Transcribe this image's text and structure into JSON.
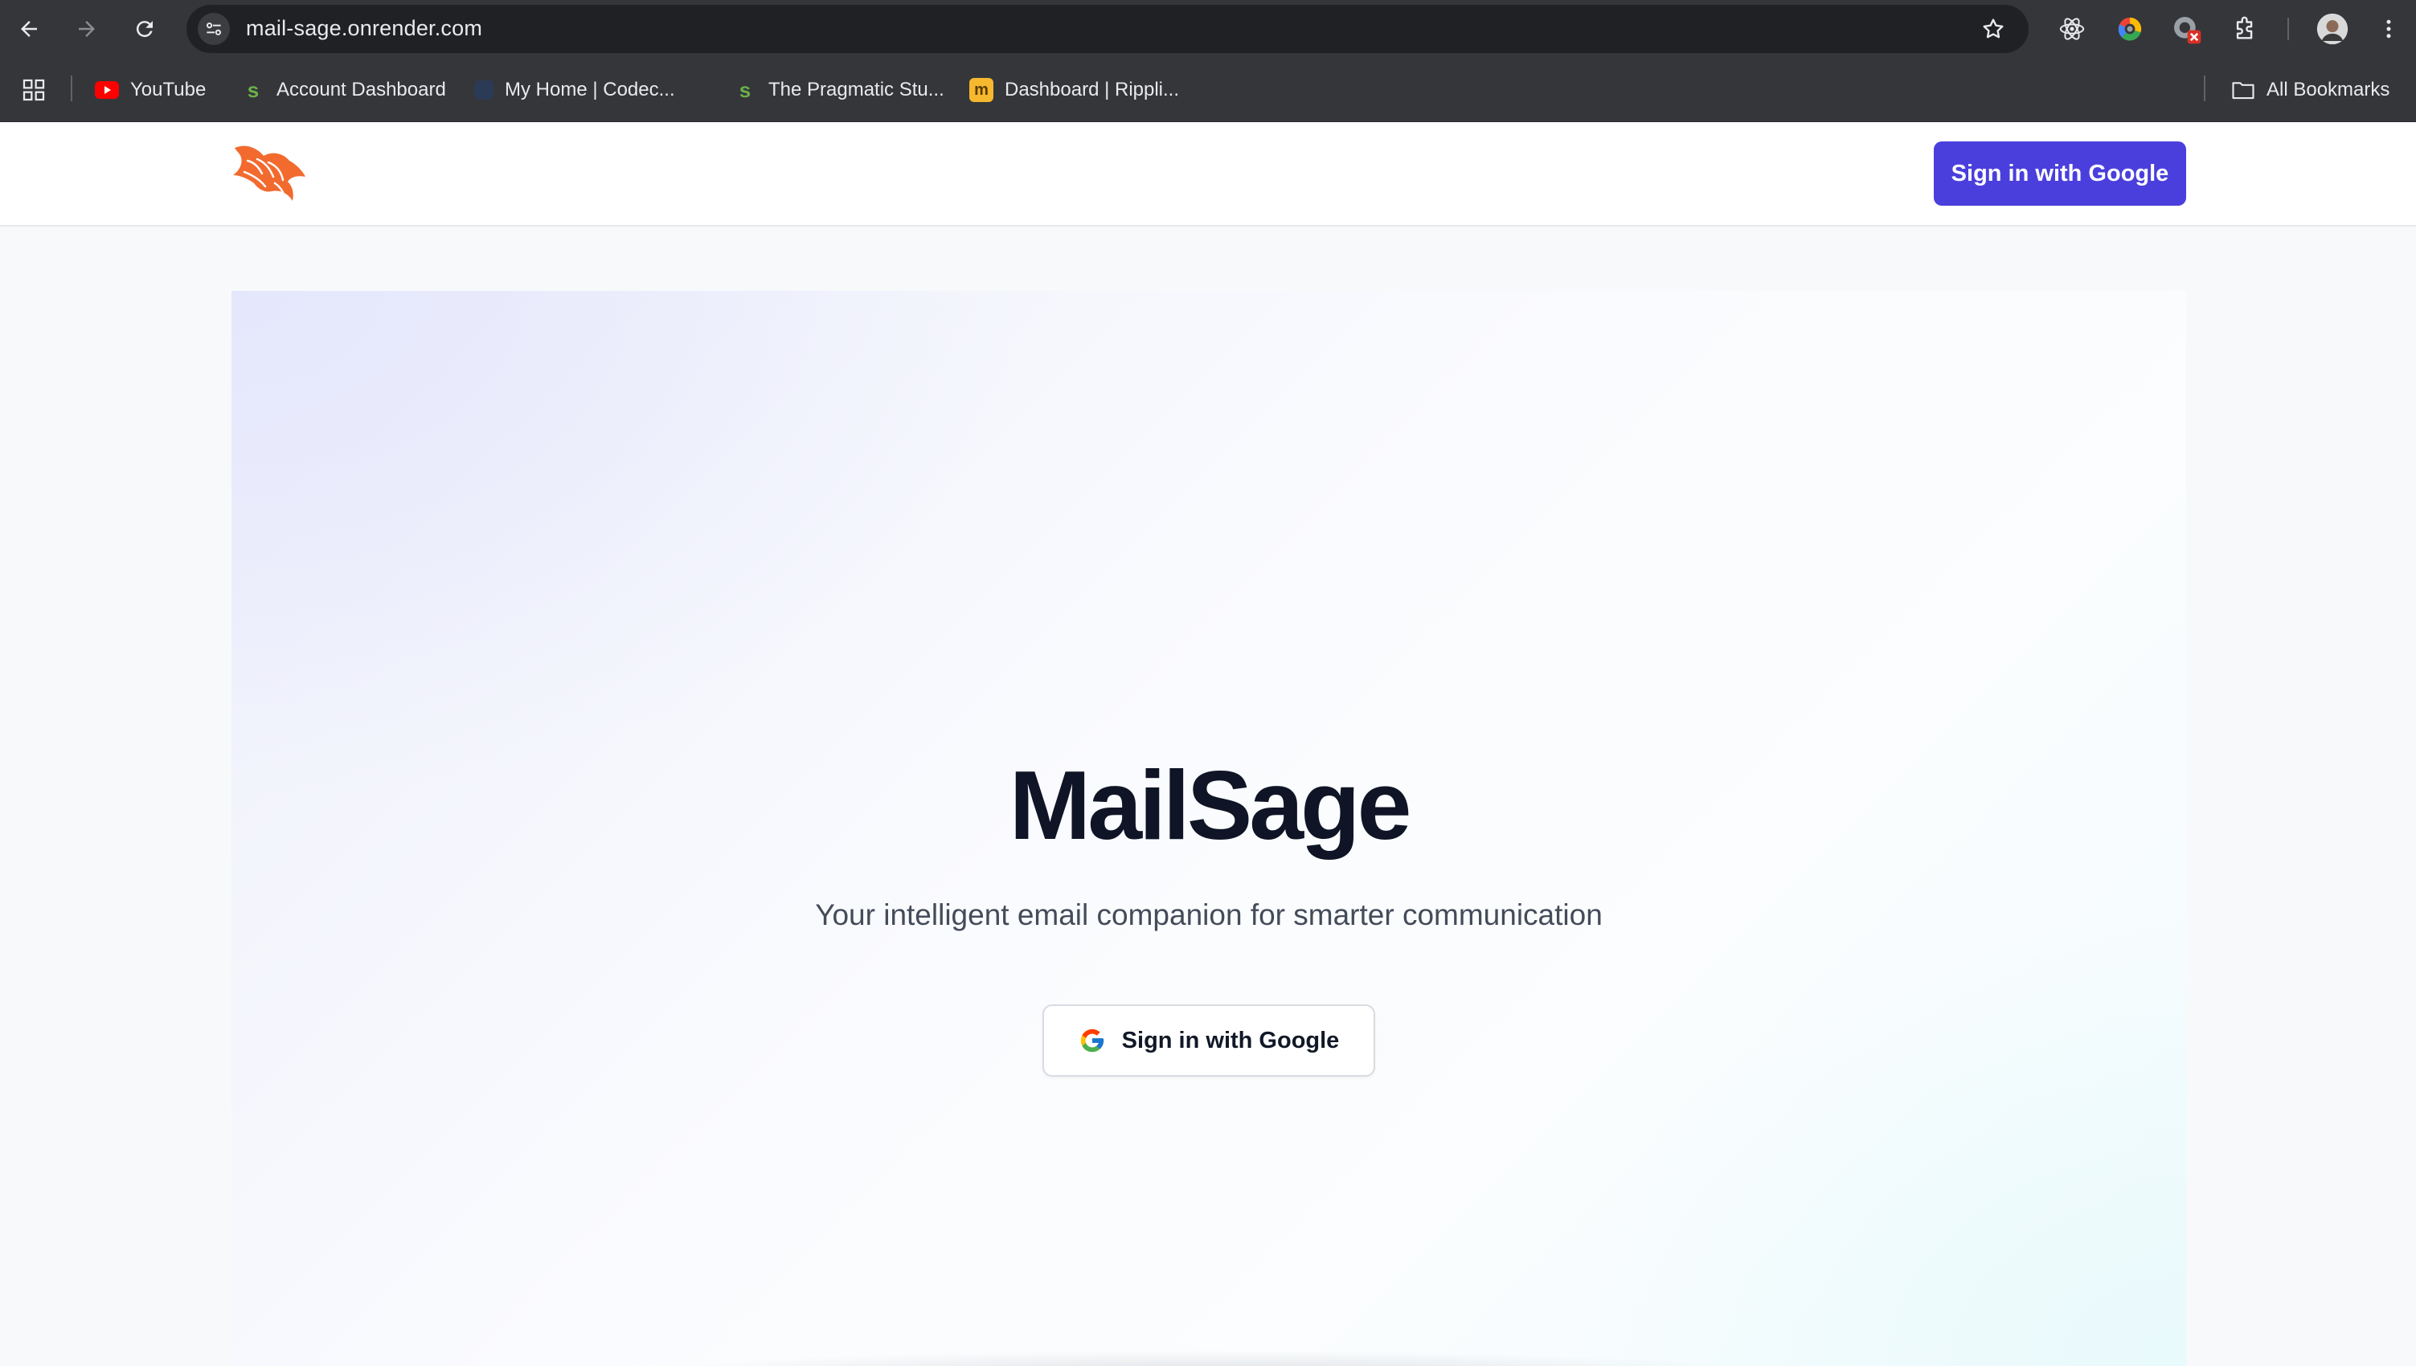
{
  "browser": {
    "url": "mail-sage.onrender.com",
    "bookmarks": [
      {
        "label": "YouTube"
      },
      {
        "label": "Account Dashboard"
      },
      {
        "label": "My Home | Codec..."
      },
      {
        "label": "The Pragmatic Stu..."
      },
      {
        "label": "Dashboard | Rippli..."
      }
    ],
    "all_bookmarks_label": "All Bookmarks"
  },
  "header": {
    "signin_label": "Sign in with Google"
  },
  "hero": {
    "title": "MailSage",
    "subtitle": "Your intelligent email companion for smarter communication",
    "signin_label": "Sign in with Google"
  },
  "colors": {
    "accent": "#4a3fdd",
    "title_text": "#0f1526",
    "logo": "#f26a2e"
  },
  "icons": [
    "back-arrow-icon",
    "forward-arrow-icon",
    "reload-icon",
    "site-info-icon",
    "bookmark-star-icon",
    "react-devtools-icon",
    "color-picker-extension-icon",
    "extension-error-icon",
    "extensions-puzzle-icon",
    "profile-avatar-icon",
    "chrome-menu-icon",
    "apps-grid-icon",
    "youtube-icon",
    "folder-icon",
    "phoenix-logo-icon",
    "google-g-icon"
  ]
}
